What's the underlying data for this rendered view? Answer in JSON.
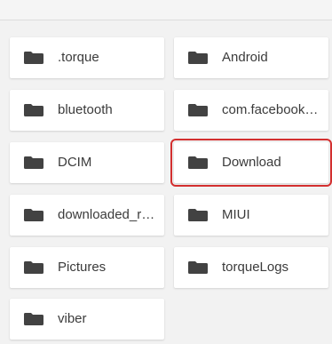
{
  "folders": [
    {
      "name": ".torque",
      "selected": false
    },
    {
      "name": "Android",
      "selected": false
    },
    {
      "name": "bluetooth",
      "selected": false
    },
    {
      "name": "com.facebook.katana",
      "selected": false
    },
    {
      "name": "DCIM",
      "selected": false
    },
    {
      "name": "Download",
      "selected": true
    },
    {
      "name": "downloaded_rom",
      "selected": false
    },
    {
      "name": "MIUI",
      "selected": false
    },
    {
      "name": "Pictures",
      "selected": false
    },
    {
      "name": "torqueLogs",
      "selected": false
    },
    {
      "name": "viber",
      "selected": false
    }
  ],
  "colors": {
    "folder_icon": "#424242",
    "selection_outline": "#d32f2f"
  },
  "icon": "folder-icon"
}
